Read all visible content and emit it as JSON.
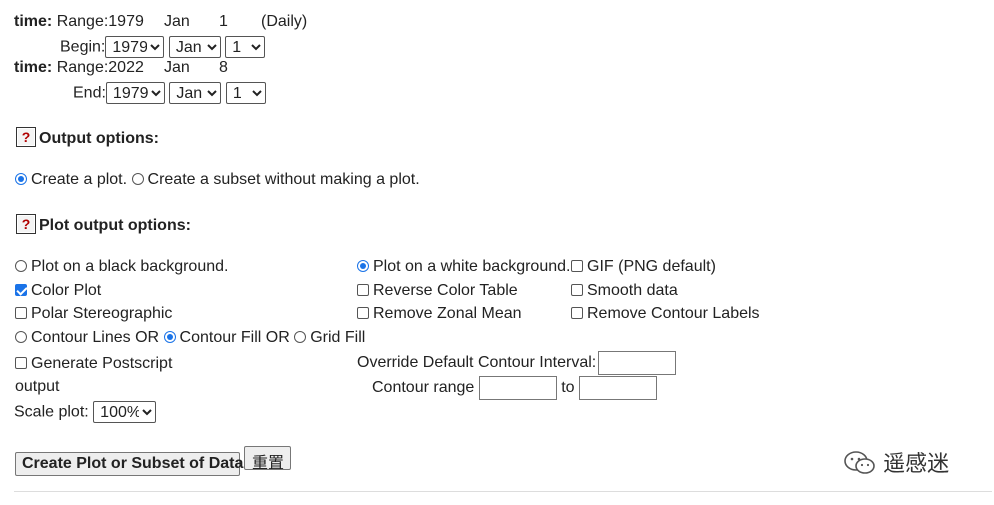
{
  "time_begin": {
    "label": "time:",
    "range_label": "Range:",
    "range_year": "1979",
    "range_month": "Jan",
    "range_day": "1",
    "range_note": "(Daily)",
    "field_label": "Begin:",
    "year": "1979",
    "month": "Jan",
    "day": "1"
  },
  "time_end": {
    "label": "time:",
    "range_label": "Range:",
    "range_year": "2022",
    "range_month": "Jan",
    "range_day": "8",
    "field_label": "End:",
    "year": "1979",
    "month": "Jan",
    "day": "1"
  },
  "output_options": {
    "title": "Output options:",
    "create_plot": "Create a plot.",
    "create_subset": "Create a subset without making a plot."
  },
  "plot_output_options": {
    "title": "Plot output options:",
    "black_bg": "Plot on a black background.",
    "white_bg": "Plot on a white background.",
    "gif": "GIF (PNG default)",
    "color_plot": "Color Plot",
    "reverse_color": "Reverse Color Table",
    "smooth": "Smooth data",
    "polar": "Polar Stereographic",
    "remove_zonal": "Remove Zonal Mean",
    "remove_contour_labels": "Remove Contour Labels",
    "contour_lines": "Contour Lines OR",
    "contour_fill": "Contour Fill OR",
    "grid_fill": "Grid Fill",
    "postscript_line1": "Generate Postscript",
    "postscript_line2": "output",
    "override_label": "Override Default Contour Interval:",
    "contour_range_label": "Contour range",
    "to_label": "to",
    "scale_label": "Scale plot:",
    "scale_value": "100%"
  },
  "buttons": {
    "submit": "Create Plot or Subset of Data",
    "reset": "重置"
  },
  "watermark": "遥感迷"
}
